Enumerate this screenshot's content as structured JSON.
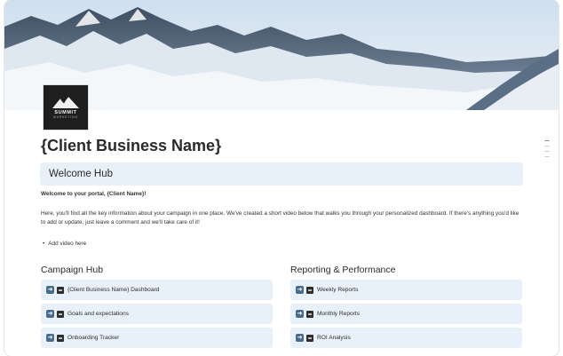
{
  "page": {
    "logo_text": "SUMMIT",
    "logo_subtext": "MARKETING",
    "title": "{Client Business Name}",
    "welcome_heading": "Welcome Hub",
    "welcome_line": "Welcome to your portal, {Client Name}!",
    "intro_text": "Here, you'll find all the key information about your campaign in one place. We've created a short video below that walks you through your personalized dashboard. If there's anything you'd like to add or update, just leave a comment and we'll take care of it!",
    "bullet_item": "Add video here"
  },
  "campaign_hub": {
    "title": "Campaign Hub",
    "items": [
      {
        "label": "{Client Business Name} Dashboard"
      },
      {
        "label": "Goals and expectations"
      },
      {
        "label": "Onboarding Tracker"
      }
    ]
  },
  "reporting": {
    "title": "Reporting & Performance",
    "items": [
      {
        "label": "Weekly Reports"
      },
      {
        "label": "Monthly Reports"
      },
      {
        "label": "ROI Analysis"
      }
    ]
  },
  "colors": {
    "callout_bg": "#e8f1fa",
    "arrow_icon": "#4a6c8c"
  }
}
